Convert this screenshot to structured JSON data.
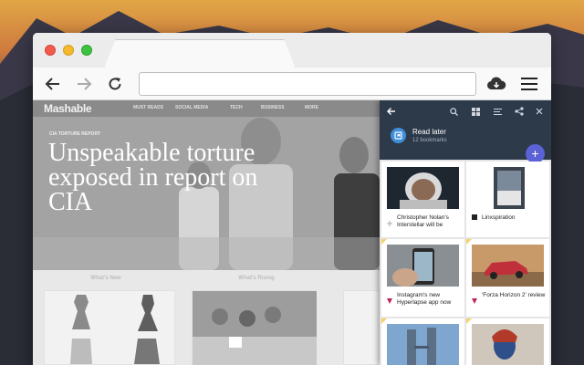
{
  "browser": {
    "url": ""
  },
  "site": {
    "logo": "Mashable",
    "nav": [
      "MUST READS",
      "SOCIAL MEDIA",
      "TECH",
      "BUSINESS",
      "MORE"
    ],
    "kicker": "CIA TORTURE REPORT",
    "headline": "Unspeakable torture exposed in report on CIA",
    "sections": [
      "What's New",
      "What's Rising"
    ]
  },
  "panel": {
    "title": "Read later",
    "subtitle": "12 bookmarks",
    "add_label": "+",
    "items": [
      {
        "caption": "Christopher Nolan's Interstellar will be",
        "favicon": "generic-icon"
      },
      {
        "caption": "Linxspiration",
        "favicon": "dark-square-icon"
      },
      {
        "caption": "Instagram's new Hyperlapse app now",
        "favicon": "verge-icon"
      },
      {
        "caption": "'Forza Horizon 2' review",
        "favicon": "verge-icon"
      },
      {
        "caption": "",
        "favicon": ""
      },
      {
        "caption": "",
        "favicon": ""
      }
    ]
  },
  "colors": {
    "panel_header": "#2d3a4a",
    "fab": "#5a62d6",
    "badge": "#3f8fd8",
    "corner": "#f3d36a"
  }
}
